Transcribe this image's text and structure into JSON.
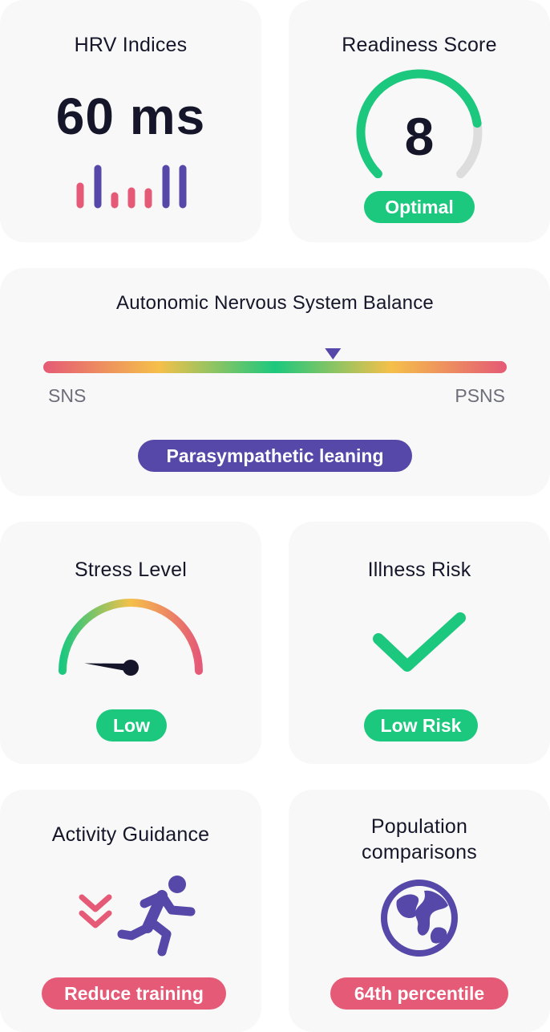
{
  "colors": {
    "green": "#1cc87e",
    "purple": "#5548a8",
    "pink": "#e55a76",
    "orange": "#f5c04a",
    "gray_track": "#dddddd",
    "dark": "#16162a"
  },
  "hrv": {
    "title": "HRV Indices",
    "value": "60 ms",
    "icon": "bar-chart-icon"
  },
  "readiness": {
    "title": "Readiness Score",
    "value": "8",
    "badge": "Optimal",
    "gauge_fraction": 0.8
  },
  "ans_balance": {
    "title": "Autonomic Nervous System Balance",
    "left_label": "SNS",
    "right_label": "PSNS",
    "marker_fraction": 0.625,
    "badge": "Parasympathetic leaning"
  },
  "stress": {
    "title": "Stress Level",
    "badge": "Low",
    "needle_fraction": 0.03
  },
  "illness": {
    "title": "Illness Risk",
    "badge": "Low Risk",
    "icon": "checkmark-icon"
  },
  "activity": {
    "title": "Activity Guidance",
    "badge": "Reduce training",
    "icons": [
      "chevron-double-down-icon",
      "running-person-icon"
    ]
  },
  "population": {
    "title_line1": "Population",
    "title_line2": "comparisons",
    "badge": "64th percentile",
    "icon": "globe-icon"
  }
}
